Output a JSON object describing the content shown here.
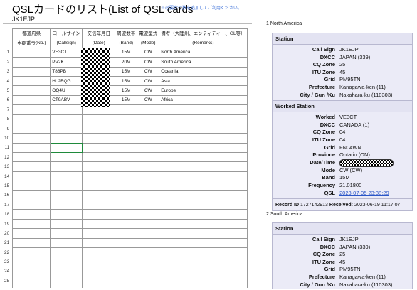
{
  "sheet": {
    "title": "QSLカードのリスト(List of QSL cards",
    "hint": "※必要な行数を追加してご利用ください。",
    "callsign": "JK1EJP",
    "headers_jp": [
      "都道府県",
      "コールサイン",
      "交信年月日",
      "周波数帯",
      "電波型式",
      "備考（大陸州、エンティティー、GL等）"
    ],
    "headers_en": [
      "市郡番号(No.)",
      "(Callsign)",
      "(Date)",
      "(Band)",
      "(Mode)",
      "(Remarks)"
    ],
    "rows": [
      {
        "n": "1",
        "call": "VE3CT",
        "band": "15M",
        "mode": "CW",
        "remarks": "North America"
      },
      {
        "n": "2",
        "call": "PV2K",
        "band": "20M",
        "mode": "CW",
        "remarks": "South America"
      },
      {
        "n": "3",
        "call": "T88PB",
        "band": "15M",
        "mode": "CW",
        "remarks": "Oceania"
      },
      {
        "n": "4",
        "call": "HL2BQG",
        "band": "15M",
        "mode": "CW",
        "remarks": "Asia"
      },
      {
        "n": "5",
        "call": "OQ4U",
        "band": "15M",
        "mode": "CW",
        "remarks": "Europe"
      },
      {
        "n": "6",
        "call": "CT9ABV",
        "band": "15M",
        "mode": "CW",
        "remarks": "Africa"
      },
      {
        "n": "7"
      },
      {
        "n": "8"
      },
      {
        "n": "9"
      },
      {
        "n": "10"
      },
      {
        "n": "11"
      },
      {
        "n": "12"
      },
      {
        "n": "13"
      },
      {
        "n": "14"
      },
      {
        "n": "15"
      },
      {
        "n": "16"
      },
      {
        "n": "17"
      },
      {
        "n": "18"
      },
      {
        "n": "19"
      },
      {
        "n": "20"
      },
      {
        "n": "21"
      },
      {
        "n": "22"
      },
      {
        "n": "23"
      },
      {
        "n": "24"
      },
      {
        "n": "25"
      },
      {
        "n": "26"
      }
    ]
  },
  "panel": {
    "sections": [
      {
        "title": "1 North America",
        "station_head": "Station",
        "station": [
          {
            "k": "Call Sign",
            "v": "JK1EJP"
          },
          {
            "k": "DXCC",
            "v": "JAPAN (339)"
          },
          {
            "k": "CQ Zone",
            "v": "25"
          },
          {
            "k": "ITU Zone",
            "v": "45"
          },
          {
            "k": "Grid",
            "v": "PM95TN"
          },
          {
            "k": "Prefecture",
            "v": "Kanagawa-ken (11)"
          },
          {
            "k": "City / Gun /Ku",
            "v": "Nakahara-ku (110303)"
          }
        ],
        "worked_head": "Worked Station",
        "worked": [
          {
            "k": "Worked",
            "v": "VE3CT"
          },
          {
            "k": "DXCC",
            "v": "CANADA (1)"
          },
          {
            "k": "CQ Zone",
            "v": "04"
          },
          {
            "k": "ITU Zone",
            "v": "04"
          },
          {
            "k": "Grid",
            "v": "FN04WN"
          },
          {
            "k": "Province",
            "v": "Ontario (ON)"
          },
          {
            "k": "Date/Time",
            "v": ""
          },
          {
            "k": "Mode",
            "v": "CW (CW)"
          },
          {
            "k": "Band",
            "v": "15M"
          },
          {
            "k": "Frequency",
            "v": "21.01800"
          },
          {
            "k": "QSL",
            "v": "2023-07-05 23:38:29"
          }
        ],
        "record_label": "Record ID",
        "record_id": "1727142913",
        "received_label": "Received:",
        "received": "2023-06-19 11:17:07"
      },
      {
        "title": "2 South America",
        "station_head": "Station",
        "station": [
          {
            "k": "Call Sign",
            "v": "JK1EJP"
          },
          {
            "k": "DXCC",
            "v": "JAPAN (339)"
          },
          {
            "k": "CQ Zone",
            "v": "25"
          },
          {
            "k": "ITU Zone",
            "v": "45"
          },
          {
            "k": "Grid",
            "v": "PM95TN"
          },
          {
            "k": "Prefecture",
            "v": "Kanagawa-ken (11)"
          },
          {
            "k": "City / Gun /Ku",
            "v": "Nakahara-ku (110303)"
          }
        ]
      }
    ]
  }
}
